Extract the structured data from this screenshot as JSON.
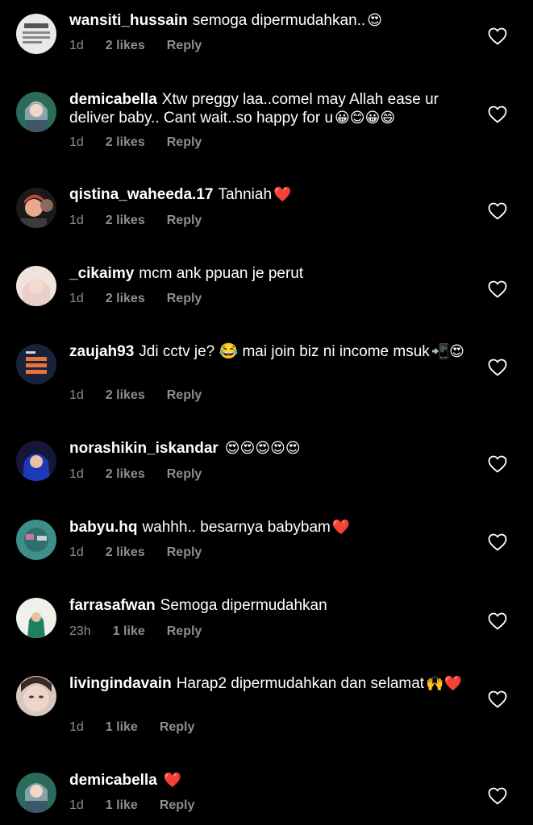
{
  "colors": {
    "background": "#000000",
    "text": "#ffffff",
    "secondary": "#8e8e8e",
    "heart_emoji": "#e0262f"
  },
  "comments": [
    {
      "username": "wansiti_hussain",
      "text": "semoga dipermudahkan..",
      "emoji": "😍",
      "time": "1d",
      "likes": "2 likes",
      "reply": "Reply",
      "avatar": "avatar-1"
    },
    {
      "username": "demicabella",
      "text": "Xtw preggy laa..comel may Allah ease ur deliver baby.. Cant wait..so happy for u",
      "emoji": "😀😊😀😄",
      "time": "1d",
      "likes": "2 likes",
      "reply": "Reply",
      "avatar": "avatar-2"
    },
    {
      "username": "qistina_waheeda.17",
      "text": "Tahniah",
      "emoji": "❤️",
      "time": "1d",
      "likes": "2 likes",
      "reply": "Reply",
      "avatar": "avatar-3"
    },
    {
      "username": "_cikaimy",
      "text": "mcm ank ppuan je perut",
      "emoji": "",
      "time": "1d",
      "likes": "2 likes",
      "reply": "Reply",
      "avatar": "avatar-4"
    },
    {
      "username": "zaujah93",
      "text": "Jdi cctv je? 😂 mai join biz ni income msuk",
      "emoji": "📲😍",
      "time": "1d",
      "likes": "2 likes",
      "reply": "Reply",
      "avatar": "avatar-5"
    },
    {
      "username": "norashikin_iskandar",
      "text": "",
      "emoji": "😍😍😍😍😍",
      "time": "1d",
      "likes": "2 likes",
      "reply": "Reply",
      "avatar": "avatar-6"
    },
    {
      "username": "babyu.hq",
      "text": "wahhh.. besarnya babybam",
      "emoji": "❤️",
      "time": "1d",
      "likes": "2 likes",
      "reply": "Reply",
      "avatar": "avatar-7"
    },
    {
      "username": "farrasafwan",
      "text": "Semoga dipermudahkan",
      "emoji": "",
      "time": "23h",
      "likes": "1 like",
      "reply": "Reply",
      "avatar": "avatar-8"
    },
    {
      "username": "livingindavain",
      "text": "Harap2 dipermudahkan dan selamat",
      "emoji": "🙌❤️",
      "time": "1d",
      "likes": "1 like",
      "reply": "Reply",
      "avatar": "avatar-9"
    },
    {
      "username": "demicabella",
      "text": "",
      "emoji": "❤️",
      "time": "1d",
      "likes": "1 like",
      "reply": "Reply",
      "avatar": "avatar-10"
    }
  ]
}
